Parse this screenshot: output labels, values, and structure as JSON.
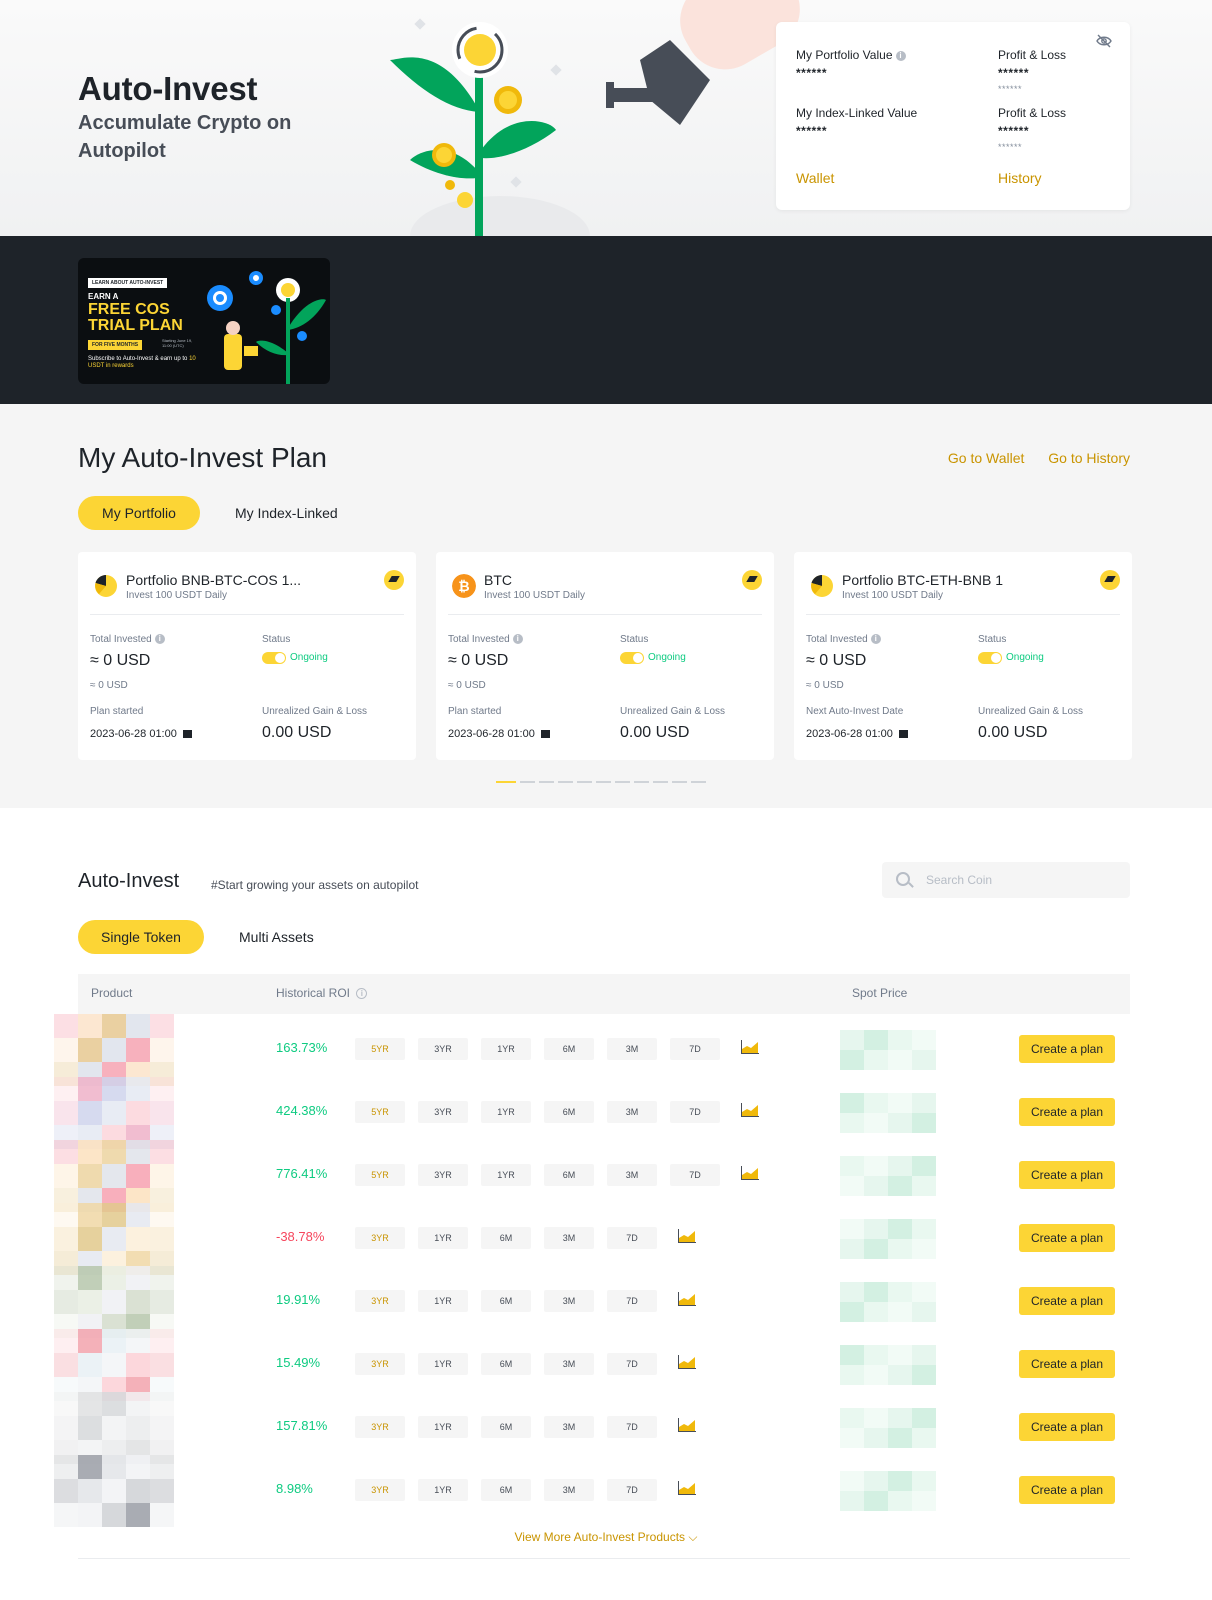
{
  "hero": {
    "title": "Auto-Invest",
    "subtitle": "Accumulate Crypto on Autopilot"
  },
  "summary": {
    "portfolio_value_label": "My Portfolio Value",
    "portfolio_value": "******",
    "pnl_label_1": "Profit & Loss",
    "pnl_value_1": "******",
    "pnl_sub_1": "******",
    "index_value_label": "My Index-Linked Value",
    "index_value": "******",
    "pnl_label_2": "Profit & Loss",
    "pnl_value_2": "******",
    "pnl_sub_2": "******",
    "wallet_link": "Wallet",
    "history_link": "History"
  },
  "promo": {
    "tag": "LEARN ABOUT AUTO-INVEST",
    "earn": "EARN A",
    "headline": "FREE COS TRIAL PLAN",
    "pill": "FOR FIVE MONTHS",
    "start": "Starting June 19, 11:00 (UTC)",
    "sub_prefix": "Subscribe to Auto-Invest & earn up to ",
    "sub_highlight": "10 USDT in rewards"
  },
  "plan": {
    "title": "My Auto-Invest Plan",
    "go_wallet": "Go to Wallet",
    "go_history": "Go to History",
    "tabs": [
      "My Portfolio",
      "My Index-Linked"
    ],
    "cards": [
      {
        "name": "Portfolio BNB-BTC-COS 1...",
        "sub": "Invest 100 USDT Daily",
        "icon": "pie-chart-icon",
        "total_invested_label": "Total Invested",
        "total_invested": "≈ 0 USD",
        "total_invested_sub": "≈ 0 USD",
        "status_label": "Status",
        "status": "Ongoing",
        "date_label": "Plan started",
        "date": "2023-06-28 01:00",
        "pnl_label": "Unrealized Gain & Loss",
        "pnl": "0.00 USD"
      },
      {
        "name": "BTC",
        "sub": "Invest 100 USDT Daily",
        "icon": "bitcoin-icon",
        "total_invested_label": "Total Invested",
        "total_invested": "≈ 0 USD",
        "total_invested_sub": "≈ 0 USD",
        "status_label": "Status",
        "status": "Ongoing",
        "date_label": "Plan started",
        "date": "2023-06-28 01:00",
        "pnl_label": "Unrealized Gain & Loss",
        "pnl": "0.00 USD"
      },
      {
        "name": "Portfolio BTC-ETH-BNB 1",
        "sub": "Invest 100 USDT Daily",
        "icon": "pie-chart-icon",
        "total_invested_label": "Total Invested",
        "total_invested": "≈ 0 USD",
        "total_invested_sub": "≈ 0 USD",
        "status_label": "Status",
        "status": "Ongoing",
        "date_label": "Next Auto-Invest Date",
        "date": "2023-06-28 01:00",
        "pnl_label": "Unrealized Gain & Loss",
        "pnl": "0.00 USD"
      }
    ],
    "pagination_dots": 11,
    "active_dot": 0
  },
  "auto_invest": {
    "title": "Auto-Invest",
    "tagline": "#Start growing your assets on autopilot",
    "search_placeholder": "Search Coin",
    "tabs": [
      "Single Token",
      "Multi Assets"
    ],
    "columns": {
      "product": "Product",
      "roi": "Historical ROI",
      "price": "Spot Price"
    },
    "create_label": "Create a plan",
    "view_more": "View More Auto-Invest Products",
    "rows": [
      {
        "roi": "163.73%",
        "dir": "pos",
        "periods": [
          "5YR",
          "3YR",
          "1YR",
          "6M",
          "3M",
          "7D"
        ]
      },
      {
        "roi": "424.38%",
        "dir": "pos",
        "periods": [
          "5YR",
          "3YR",
          "1YR",
          "6M",
          "3M",
          "7D"
        ]
      },
      {
        "roi": "776.41%",
        "dir": "pos",
        "periods": [
          "5YR",
          "3YR",
          "1YR",
          "6M",
          "3M",
          "7D"
        ]
      },
      {
        "roi": "-38.78%",
        "dir": "neg",
        "periods": [
          "3YR",
          "1YR",
          "6M",
          "3M",
          "7D"
        ]
      },
      {
        "roi": "19.91%",
        "dir": "pos",
        "periods": [
          "3YR",
          "1YR",
          "6M",
          "3M",
          "7D"
        ]
      },
      {
        "roi": "15.49%",
        "dir": "pos",
        "periods": [
          "3YR",
          "1YR",
          "6M",
          "3M",
          "7D"
        ]
      },
      {
        "roi": "157.81%",
        "dir": "pos",
        "periods": [
          "3YR",
          "1YR",
          "6M",
          "3M",
          "7D"
        ]
      },
      {
        "roi": "8.98%",
        "dir": "pos",
        "periods": [
          "3YR",
          "1YR",
          "6M",
          "3M",
          "7D"
        ]
      }
    ]
  },
  "colors": {
    "accent": "#fcd535",
    "link": "#c99400",
    "positive": "#0ecb81",
    "negative": "#f6465d",
    "dark_strip": "#1e2329"
  }
}
